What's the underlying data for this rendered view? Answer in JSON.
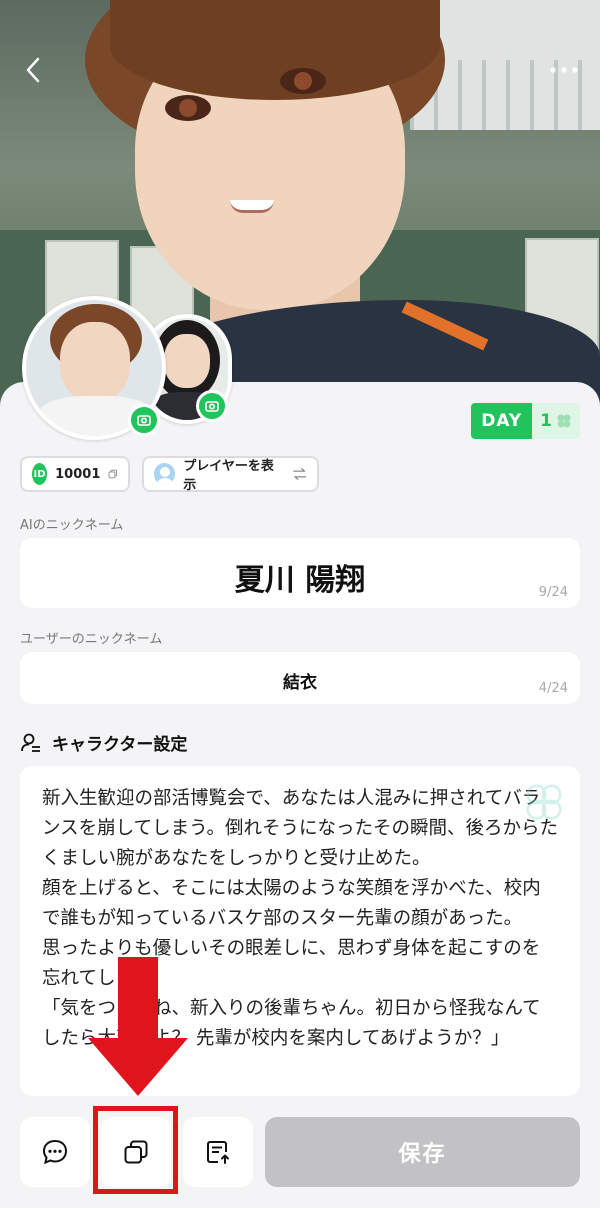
{
  "header": {
    "back_icon": "chevron-left-icon",
    "more_icon": "more-dots-icon"
  },
  "profile": {
    "day_label": "DAY",
    "day_count": "1",
    "id_badge": "ID",
    "id_value": "10001",
    "player_label": "プレイヤーを表示"
  },
  "ai_nickname": {
    "label": "AIのニックネーム",
    "value": "夏川 陽翔",
    "counter": "9/24"
  },
  "user_nickname": {
    "label": "ユーザーのニックネーム",
    "value": "結衣",
    "counter": "4/24"
  },
  "character_settings": {
    "title": "キャラクター設定",
    "text": "新入生歓迎の部活博覧会で、あなたは人混みに押されてバランスを崩してしまう。倒れそうになったその瞬間、後ろからたくましい腕があなたをしっかりと受け止めた。\n顔を上げると、そこには太陽のような笑顔を浮かべた、校内で誰もが知っているバスケ部のスター先輩の顔があった。\n思ったよりも優しいその眼差しに、思わず身体を起こすのを忘れてしまう。\n「気をつけてね、新入りの後輩ちゃん。初日から怪我なんてしたら大変だよ？ 先輩が校内を案内してあげようか？」"
  },
  "bottom_bar": {
    "save_label": "保存",
    "icons": [
      "chat-bubble-icon",
      "copy-icon",
      "export-note-icon"
    ]
  },
  "colors": {
    "accent_green": "#21c45c",
    "annotation_red": "#e0141c",
    "save_disabled": "#c2c2c5"
  }
}
